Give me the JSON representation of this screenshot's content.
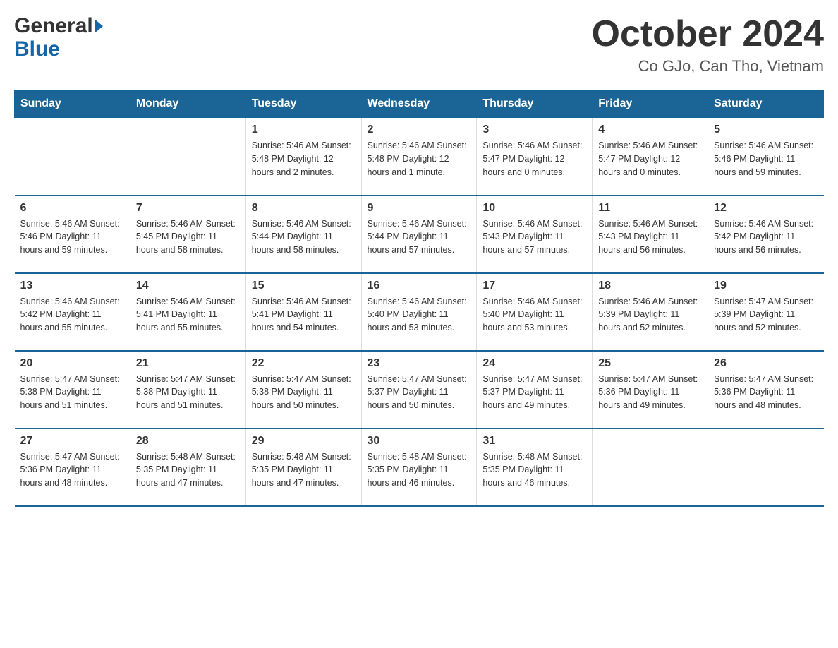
{
  "header": {
    "title": "October 2024",
    "subtitle": "Co GJo, Can Tho, Vietnam",
    "logo_general": "General",
    "logo_blue": "Blue"
  },
  "days_of_week": [
    "Sunday",
    "Monday",
    "Tuesday",
    "Wednesday",
    "Thursday",
    "Friday",
    "Saturday"
  ],
  "weeks": [
    [
      {
        "day": "",
        "info": ""
      },
      {
        "day": "",
        "info": ""
      },
      {
        "day": "1",
        "info": "Sunrise: 5:46 AM\nSunset: 5:48 PM\nDaylight: 12 hours\nand 2 minutes."
      },
      {
        "day": "2",
        "info": "Sunrise: 5:46 AM\nSunset: 5:48 PM\nDaylight: 12 hours\nand 1 minute."
      },
      {
        "day": "3",
        "info": "Sunrise: 5:46 AM\nSunset: 5:47 PM\nDaylight: 12 hours\nand 0 minutes."
      },
      {
        "day": "4",
        "info": "Sunrise: 5:46 AM\nSunset: 5:47 PM\nDaylight: 12 hours\nand 0 minutes."
      },
      {
        "day": "5",
        "info": "Sunrise: 5:46 AM\nSunset: 5:46 PM\nDaylight: 11 hours\nand 59 minutes."
      }
    ],
    [
      {
        "day": "6",
        "info": "Sunrise: 5:46 AM\nSunset: 5:46 PM\nDaylight: 11 hours\nand 59 minutes."
      },
      {
        "day": "7",
        "info": "Sunrise: 5:46 AM\nSunset: 5:45 PM\nDaylight: 11 hours\nand 58 minutes."
      },
      {
        "day": "8",
        "info": "Sunrise: 5:46 AM\nSunset: 5:44 PM\nDaylight: 11 hours\nand 58 minutes."
      },
      {
        "day": "9",
        "info": "Sunrise: 5:46 AM\nSunset: 5:44 PM\nDaylight: 11 hours\nand 57 minutes."
      },
      {
        "day": "10",
        "info": "Sunrise: 5:46 AM\nSunset: 5:43 PM\nDaylight: 11 hours\nand 57 minutes."
      },
      {
        "day": "11",
        "info": "Sunrise: 5:46 AM\nSunset: 5:43 PM\nDaylight: 11 hours\nand 56 minutes."
      },
      {
        "day": "12",
        "info": "Sunrise: 5:46 AM\nSunset: 5:42 PM\nDaylight: 11 hours\nand 56 minutes."
      }
    ],
    [
      {
        "day": "13",
        "info": "Sunrise: 5:46 AM\nSunset: 5:42 PM\nDaylight: 11 hours\nand 55 minutes."
      },
      {
        "day": "14",
        "info": "Sunrise: 5:46 AM\nSunset: 5:41 PM\nDaylight: 11 hours\nand 55 minutes."
      },
      {
        "day": "15",
        "info": "Sunrise: 5:46 AM\nSunset: 5:41 PM\nDaylight: 11 hours\nand 54 minutes."
      },
      {
        "day": "16",
        "info": "Sunrise: 5:46 AM\nSunset: 5:40 PM\nDaylight: 11 hours\nand 53 minutes."
      },
      {
        "day": "17",
        "info": "Sunrise: 5:46 AM\nSunset: 5:40 PM\nDaylight: 11 hours\nand 53 minutes."
      },
      {
        "day": "18",
        "info": "Sunrise: 5:46 AM\nSunset: 5:39 PM\nDaylight: 11 hours\nand 52 minutes."
      },
      {
        "day": "19",
        "info": "Sunrise: 5:47 AM\nSunset: 5:39 PM\nDaylight: 11 hours\nand 52 minutes."
      }
    ],
    [
      {
        "day": "20",
        "info": "Sunrise: 5:47 AM\nSunset: 5:38 PM\nDaylight: 11 hours\nand 51 minutes."
      },
      {
        "day": "21",
        "info": "Sunrise: 5:47 AM\nSunset: 5:38 PM\nDaylight: 11 hours\nand 51 minutes."
      },
      {
        "day": "22",
        "info": "Sunrise: 5:47 AM\nSunset: 5:38 PM\nDaylight: 11 hours\nand 50 minutes."
      },
      {
        "day": "23",
        "info": "Sunrise: 5:47 AM\nSunset: 5:37 PM\nDaylight: 11 hours\nand 50 minutes."
      },
      {
        "day": "24",
        "info": "Sunrise: 5:47 AM\nSunset: 5:37 PM\nDaylight: 11 hours\nand 49 minutes."
      },
      {
        "day": "25",
        "info": "Sunrise: 5:47 AM\nSunset: 5:36 PM\nDaylight: 11 hours\nand 49 minutes."
      },
      {
        "day": "26",
        "info": "Sunrise: 5:47 AM\nSunset: 5:36 PM\nDaylight: 11 hours\nand 48 minutes."
      }
    ],
    [
      {
        "day": "27",
        "info": "Sunrise: 5:47 AM\nSunset: 5:36 PM\nDaylight: 11 hours\nand 48 minutes."
      },
      {
        "day": "28",
        "info": "Sunrise: 5:48 AM\nSunset: 5:35 PM\nDaylight: 11 hours\nand 47 minutes."
      },
      {
        "day": "29",
        "info": "Sunrise: 5:48 AM\nSunset: 5:35 PM\nDaylight: 11 hours\nand 47 minutes."
      },
      {
        "day": "30",
        "info": "Sunrise: 5:48 AM\nSunset: 5:35 PM\nDaylight: 11 hours\nand 46 minutes."
      },
      {
        "day": "31",
        "info": "Sunrise: 5:48 AM\nSunset: 5:35 PM\nDaylight: 11 hours\nand 46 minutes."
      },
      {
        "day": "",
        "info": ""
      },
      {
        "day": "",
        "info": ""
      }
    ]
  ]
}
